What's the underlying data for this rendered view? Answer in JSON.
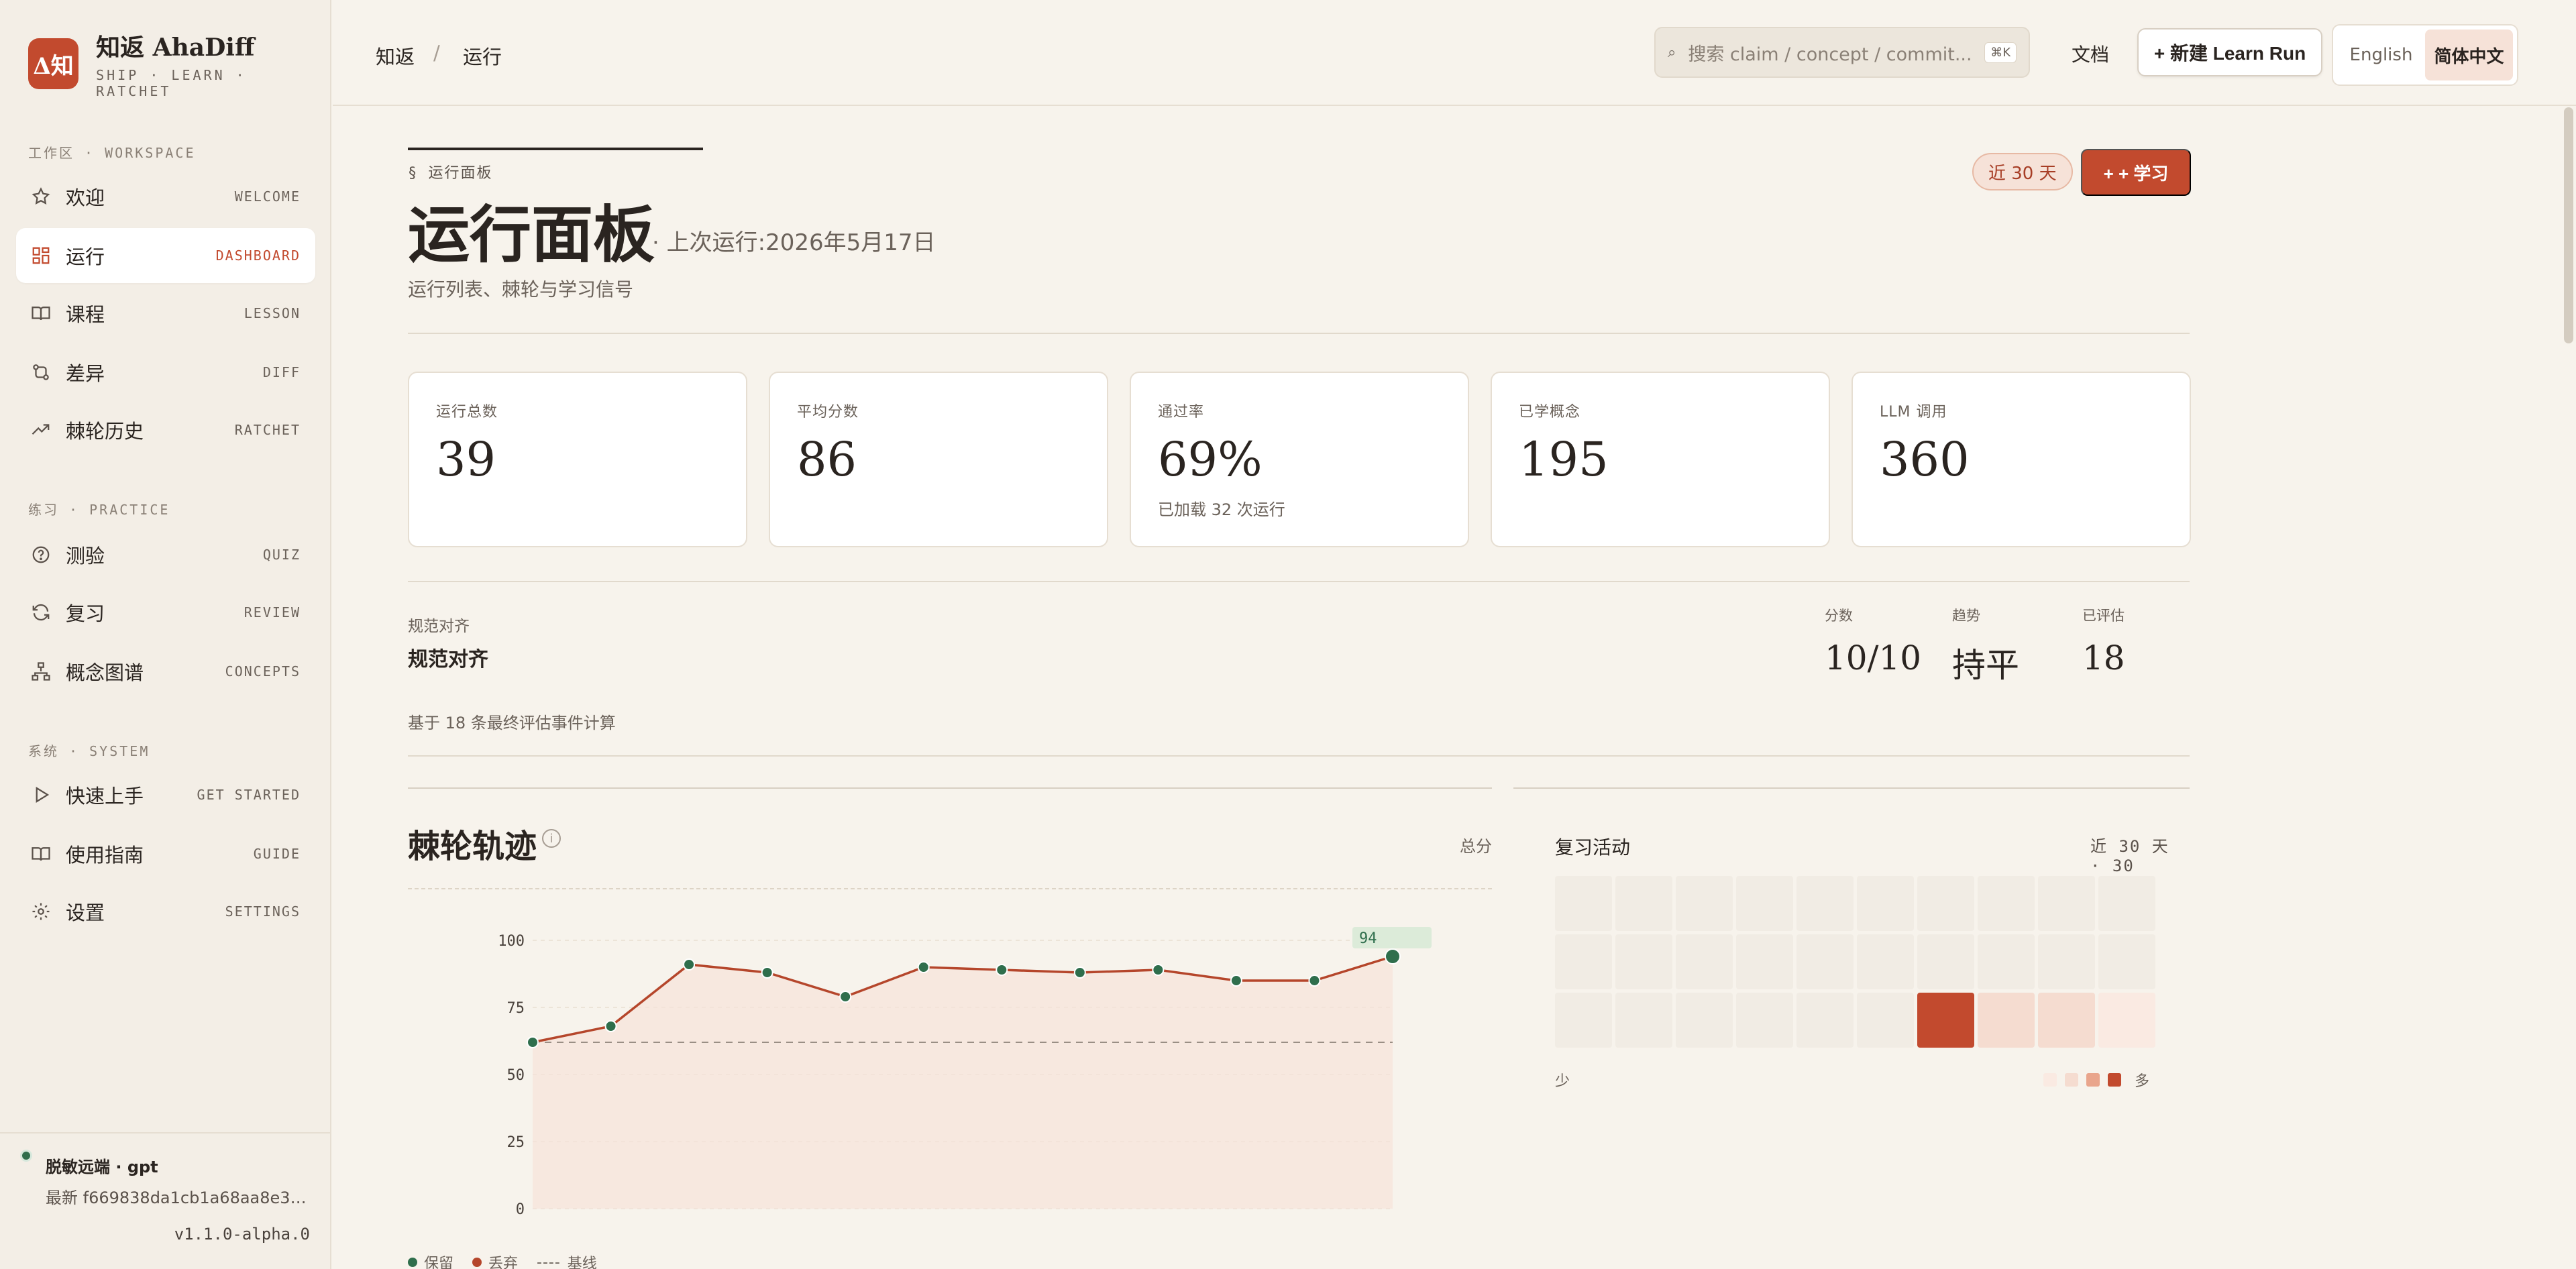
{
  "brand": {
    "logo_text": "Δ知",
    "name": "知返 AhaDiff",
    "tagline": "SHIP · LEARN · RATCHET"
  },
  "sidebar": {
    "sections": [
      {
        "label": "工作区 · WORKSPACE"
      },
      {
        "label": "练习 · PRACTICE"
      },
      {
        "label": "系统 · SYSTEM"
      }
    ],
    "items": [
      {
        "label": "欢迎",
        "code": "WELCOME",
        "icon": "star-icon"
      },
      {
        "label": "运行",
        "code": "DASHBOARD",
        "icon": "grid-icon",
        "active": true
      },
      {
        "label": "课程",
        "code": "LESSON",
        "icon": "book-icon"
      },
      {
        "label": "差异",
        "code": "DIFF",
        "icon": "git-diff-icon"
      },
      {
        "label": "棘轮历史",
        "code": "RATCHET",
        "icon": "trend-up-icon"
      },
      {
        "label": "测验",
        "code": "QUIZ",
        "icon": "question-icon"
      },
      {
        "label": "复习",
        "code": "REVIEW",
        "icon": "refresh-icon"
      },
      {
        "label": "概念图谱",
        "code": "CONCEPTS",
        "icon": "graph-icon"
      },
      {
        "label": "快速上手",
        "code": "GET STARTED",
        "icon": "play-icon"
      },
      {
        "label": "使用指南",
        "code": "GUIDE",
        "icon": "book-open-icon"
      },
      {
        "label": "设置",
        "code": "SETTINGS",
        "icon": "gear-icon"
      }
    ],
    "footer": {
      "remote": "脱敏远端 · gpt",
      "commit": "最新 f669838da1cb1a68aa8e343...",
      "version": "v1.1.0-alpha.0"
    }
  },
  "topbar": {
    "breadcrumb": [
      "知返",
      "运行"
    ],
    "breadcrumb_sep": "/",
    "search": {
      "icon": "⌕",
      "placeholder": "搜索 claim / concept / commit...",
      "shortcut": "⌘K"
    },
    "docs": "文档",
    "new_run": "+ 新建 Learn Run",
    "languages": [
      {
        "label": "English",
        "active": false
      },
      {
        "label": "简体中文",
        "active": true
      }
    ]
  },
  "header": {
    "section_label": "§  运行面板",
    "title": "运行面板",
    "last_run": "·  上次运行:2026年5月17日",
    "subtitle": "运行列表、棘轮与学习信号",
    "period": "近 30 天",
    "learn_button": "+ + 学习"
  },
  "stats": [
    {
      "label": "运行总数",
      "value": "39",
      "sub": ""
    },
    {
      "label": "平均分数",
      "value": "86",
      "sub": ""
    },
    {
      "label": "通过率",
      "value": "69%",
      "sub": "已加载 32 次运行"
    },
    {
      "label": "已学概念",
      "value": "195",
      "sub": ""
    },
    {
      "label": "LLM 调用",
      "value": "360",
      "sub": ""
    }
  ],
  "spec": {
    "small_label": "规范对齐",
    "title": "规范对齐",
    "note": "基于 18 条最终评估事件计算",
    "metrics": [
      {
        "label": "分数",
        "value": "10/10"
      },
      {
        "label": "趋势",
        "value": "持平"
      },
      {
        "label": "已评估",
        "value": "18"
      }
    ]
  },
  "chart": {
    "title": "棘轮轨迹",
    "info_icon": "i",
    "metric_label": "总分",
    "legend": [
      {
        "label": "保留",
        "color": "#2f6e4c"
      },
      {
        "label": "丢弃",
        "color": "#b5462b"
      },
      {
        "label": "基线",
        "style": "dashed"
      }
    ]
  },
  "chart_data": {
    "type": "line",
    "title": "棘轮轨迹",
    "ylabel": "总分",
    "ylim": [
      0,
      100
    ],
    "yticks": [
      0,
      25,
      50,
      75,
      100
    ],
    "baseline": 62,
    "grid": true,
    "series": [
      {
        "name": "总分",
        "values": [
          62,
          68,
          91,
          88,
          79,
          90,
          89,
          88,
          89,
          85,
          85,
          94
        ],
        "kept": [
          true,
          true,
          true,
          true,
          true,
          true,
          true,
          true,
          true,
          true,
          true,
          true
        ]
      }
    ],
    "last_label": "94",
    "line_color": "#b5462b",
    "point_color": "#2f6e4c",
    "area_color": "#f6e3da"
  },
  "activity": {
    "title": "复习活动",
    "range": "近 30 天 · 30",
    "less": "少",
    "more": "多",
    "levels": [
      0,
      0,
      0,
      0,
      0,
      0,
      0,
      0,
      0,
      0,
      0,
      0,
      0,
      0,
      0,
      0,
      0,
      0,
      0,
      0,
      0,
      0,
      0,
      0,
      0,
      0,
      4,
      2,
      2,
      1
    ],
    "colors": [
      "#f1ece4",
      "#faeae2",
      "#f5dcd0",
      "#e9a58c",
      "#c24a2e"
    ]
  }
}
